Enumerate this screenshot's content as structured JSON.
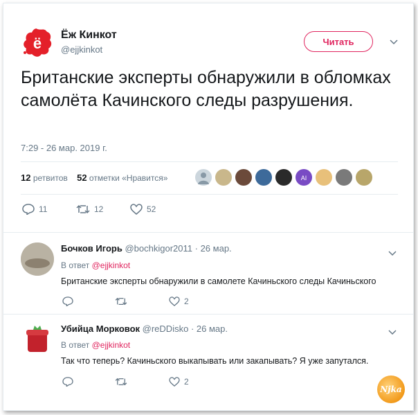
{
  "tweet": {
    "author_name": "Ёж Кинкот",
    "author_handle": "@ejjkinkot",
    "follow_label": "Читать",
    "text": "Британские эксперты обнаружили в обломках самолёта Качинского следы разрушения.",
    "timestamp": "7:29 - 26 мар. 2019 г.",
    "retweets_count": "12",
    "retweets_label": "ретвитов",
    "likes_count": "52",
    "likes_label": "отметки «Нравится»",
    "reply_action_count": "11",
    "retweet_action_count": "12",
    "like_action_count": "52"
  },
  "replies": [
    {
      "author_name": "Бочков Игорь",
      "author_handle": "@bochkigor2011",
      "date": "· 26 мар.",
      "reply_to_prefix": "В ответ",
      "reply_to_handle": "@ejjkinkot",
      "text": "Британские эксперты обнаружили в самолете Качиньского следы Качиньского",
      "like_count": "2"
    },
    {
      "author_name": "Убийца Морковок",
      "author_handle": "@reDDisko",
      "date": "· 26 мар.",
      "reply_to_prefix": "В ответ",
      "reply_to_handle": "@ejjkinkot",
      "text": "Так что теперь? Качиньского выкапывать или закапывать? Я уже запутался.",
      "like_count": "2"
    }
  ],
  "watermark": "Njka",
  "colors": {
    "accent": "#e0245e",
    "muted": "#657786",
    "divider": "#e6ecf0"
  }
}
